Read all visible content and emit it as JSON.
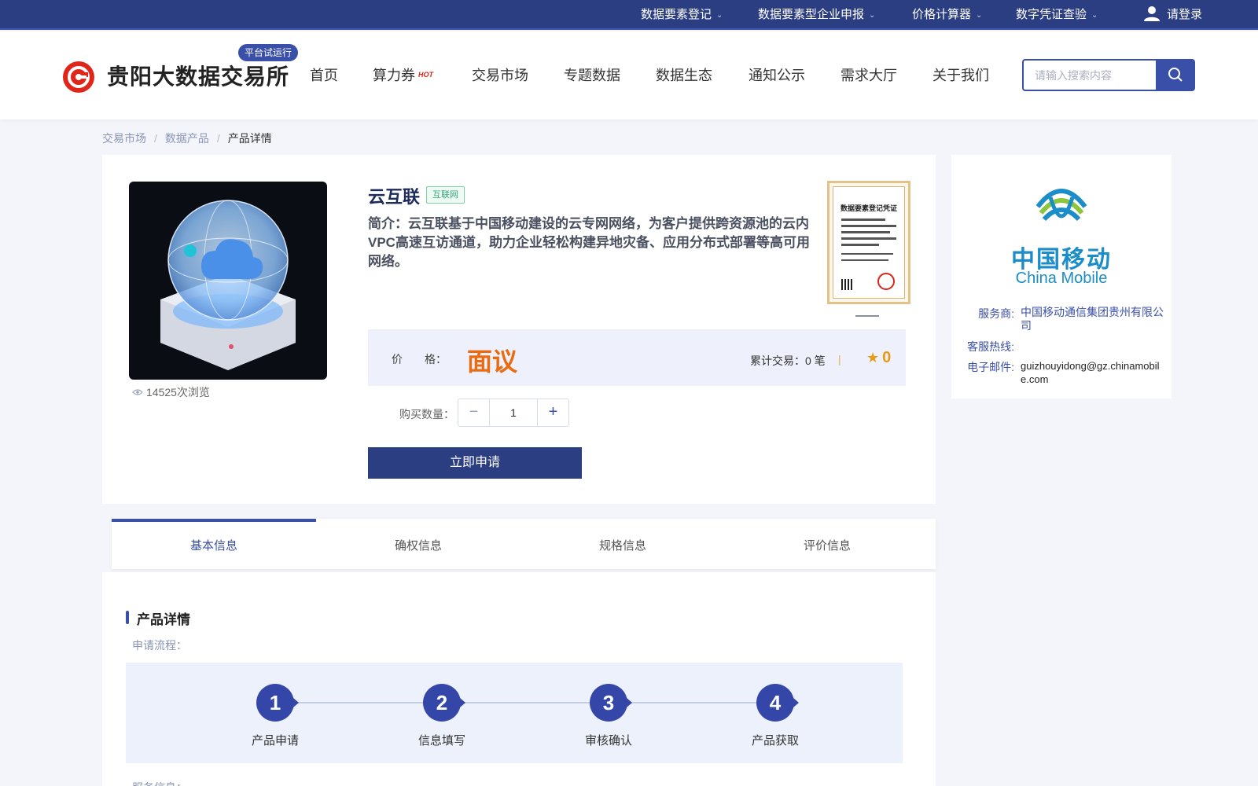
{
  "topbar": {
    "items": [
      {
        "label": "数据要素登记"
      },
      {
        "label": "数据要素型企业申报"
      },
      {
        "label": "价格计算器"
      },
      {
        "label": "数字凭证查验"
      }
    ],
    "login_label": "请登录"
  },
  "header": {
    "logo_text": "贵阳大数据交易所",
    "trial_badge": "平台试运行",
    "nav": [
      {
        "label": "首页"
      },
      {
        "label": "算力券"
      },
      {
        "label": "交易市场"
      },
      {
        "label": "专题数据"
      },
      {
        "label": "数据生态"
      },
      {
        "label": "通知公示"
      },
      {
        "label": "需求大厅"
      },
      {
        "label": "关于我们"
      }
    ],
    "hot_tag": "HOT",
    "search_placeholder": "请输入搜索内容"
  },
  "breadcrumb": {
    "items": [
      "交易市场",
      "数据产品",
      "产品详情"
    ],
    "separator": "/"
  },
  "product": {
    "title": "云互联",
    "tag": "互联网",
    "description": "简介：云互联基于中国移动建设的云专网网络，为客户提供跨资源池的云内VPC高速互访通道，助力企业轻松构建异地灾备、应用分布式部署等高可用网络。",
    "views": "14525次浏览",
    "certificate_title": "数据要素登记凭证",
    "price_label": "价　　格：",
    "price_value": "面议",
    "trade_count": "累计交易：0 笔",
    "band_separator": "|",
    "rating": "0",
    "qty_label": "购买数量：",
    "qty_value": "1",
    "qty_minus": "−",
    "qty_plus": "+",
    "apply_label": "立即申请"
  },
  "provider": {
    "logo_cn": "中国移动",
    "logo_en": "China Mobile",
    "service_label": "服务商:",
    "service_value": "中国移动通信集团贵州有限公司",
    "hotline_label": "客服热线:",
    "hotline_value": "",
    "email_label": "电子邮件:",
    "email_value": "guizhouyidong@gz.chinamobile.com"
  },
  "tabs": [
    {
      "label": "基本信息",
      "active": true
    },
    {
      "label": "确权信息",
      "active": false
    },
    {
      "label": "规格信息",
      "active": false
    },
    {
      "label": "评价信息",
      "active": false
    }
  ],
  "detail": {
    "section_title": "产品详情",
    "flow_label": "申请流程：",
    "steps": [
      {
        "num": "1",
        "label": "产品申请"
      },
      {
        "num": "2",
        "label": "信息填写"
      },
      {
        "num": "3",
        "label": "审核确认"
      },
      {
        "num": "4",
        "label": "产品获取"
      }
    ],
    "service_label": "服务信息："
  },
  "colors": {
    "primary": "#2c3e82",
    "accent": "#3a4fa8",
    "price": "#ea6b12",
    "brand_red": "#e0261b",
    "china_mobile_blue": "#1b8dc8"
  }
}
